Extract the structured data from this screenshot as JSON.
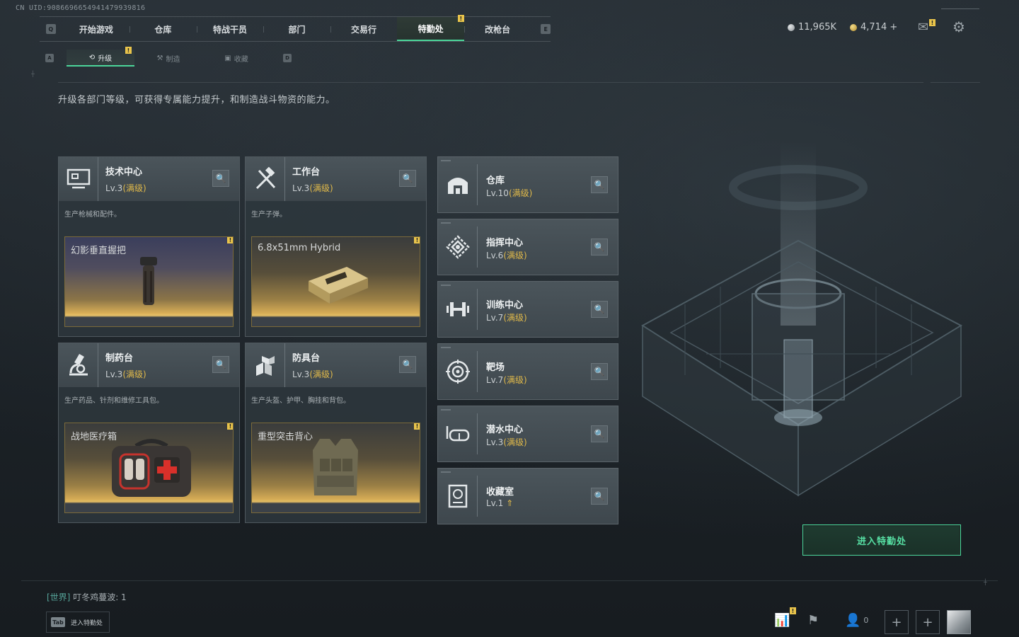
{
  "uid": "CN UID:9086696654941479939816",
  "topnav": {
    "key_left": "Q",
    "key_right": "E",
    "tabs": [
      {
        "label": "开始游戏"
      },
      {
        "label": "仓库"
      },
      {
        "label": "特战干员"
      },
      {
        "label": "部门"
      },
      {
        "label": "交易行"
      },
      {
        "label": "特勤处",
        "active": true,
        "badge": "!"
      },
      {
        "label": "改枪台"
      }
    ]
  },
  "currency": {
    "silver": "11,965K",
    "gold": "4,714 +"
  },
  "subnav": {
    "key_left": "A",
    "key_right": "D",
    "tabs": [
      {
        "label": "升级",
        "icon": "upgrade-icon",
        "active": true,
        "badge": "!"
      },
      {
        "label": "制造",
        "icon": "craft-icon"
      },
      {
        "label": "收藏",
        "icon": "collection-icon"
      }
    ]
  },
  "description": "升级各部门等级，可获得专属能力提升，和制造战斗物资的能力。",
  "big_cards": [
    {
      "title": "技术中心",
      "lv": "Lv.3",
      "max": "(满级)",
      "icon": "monitor-icon",
      "sub": "生产枪械和配件。",
      "item": "幻影垂直握把",
      "item_style": "purple"
    },
    {
      "title": "工作台",
      "lv": "Lv.3",
      "max": "(满级)",
      "icon": "tools-icon",
      "sub": "生产子弹。",
      "item": "6.8x51mm Hybrid",
      "item_style": "gold"
    },
    {
      "title": "制药台",
      "lv": "Lv.3",
      "max": "(满级)",
      "icon": "microscope-icon",
      "sub": "生产药品、针剂和维修工具包。",
      "item": "战地医疗箱",
      "item_style": "gold"
    },
    {
      "title": "防具台",
      "lv": "Lv.3",
      "max": "(满级)",
      "icon": "armor-icon",
      "sub": "生产头盔、护甲、胸挂和背包。",
      "item": "重型突击背心",
      "item_style": "gold"
    }
  ],
  "small_cards": [
    {
      "title": "仓库",
      "lv": "Lv.10",
      "max": "(满级)",
      "icon": "warehouse-icon"
    },
    {
      "title": "指挥中心",
      "lv": "Lv.6",
      "max": "(满级)",
      "icon": "command-icon"
    },
    {
      "title": "训练中心",
      "lv": "Lv.7",
      "max": "(满级)",
      "icon": "dumbbell-icon"
    },
    {
      "title": "靶场",
      "lv": "Lv.7",
      "max": "(满级)",
      "icon": "target-icon"
    },
    {
      "title": "潜水中心",
      "lv": "Lv.3",
      "max": "(满级)",
      "icon": "diving-mask-icon"
    },
    {
      "title": "收藏室",
      "lv": "Lv.1",
      "max": "",
      "up": "≈",
      "icon": "collection-room-icon"
    }
  ],
  "enter_button": "进入特勤处",
  "chat": {
    "channel": "[世界]",
    "message": "叮冬鸡蔓波: 1"
  },
  "tab_hint": {
    "key": "Tab",
    "label": "进入特勤处"
  },
  "bottom": {
    "friends_count": "0"
  },
  "colors": {
    "accent": "#4bd69a",
    "gold": "#e0b94a",
    "badge": "#e9c44b"
  }
}
